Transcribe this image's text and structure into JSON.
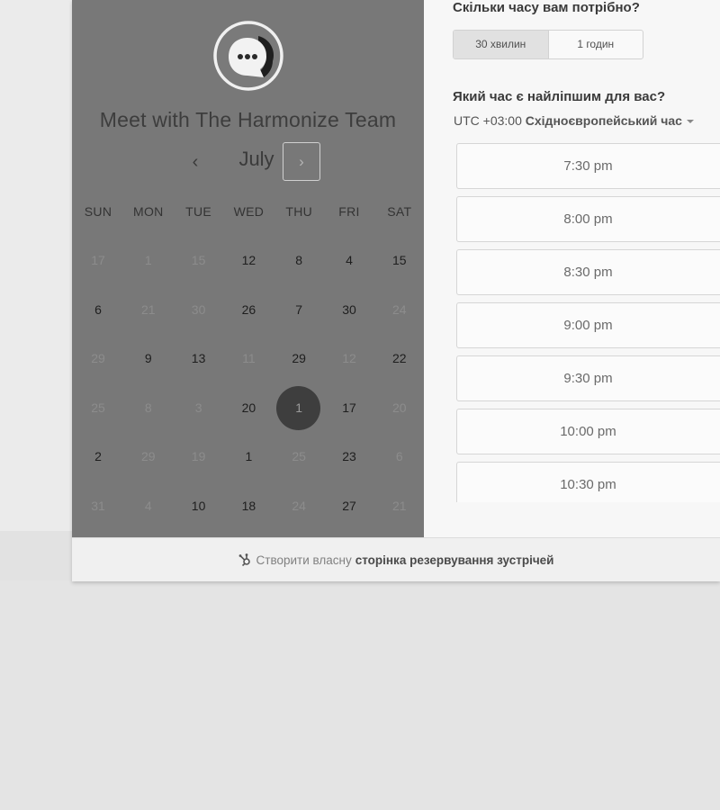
{
  "organizer": {
    "title": "Meet with The Harmonize Team",
    "logo_icon": "chat-bubble-dots-icon"
  },
  "calendar": {
    "month": "July",
    "prev_label": "‹",
    "next_label": "›",
    "weekdays": [
      "SUN",
      "MON",
      "TUE",
      "WED",
      "THU",
      "FRI",
      "SAT"
    ],
    "weeks": [
      [
        {
          "d": "17",
          "s": "inactive"
        },
        {
          "d": "1",
          "s": "inactive"
        },
        {
          "d": "15",
          "s": "inactive"
        },
        {
          "d": "12",
          "s": "active"
        },
        {
          "d": "8",
          "s": "active"
        },
        {
          "d": "4",
          "s": "active"
        },
        {
          "d": "15",
          "s": "active"
        }
      ],
      [
        {
          "d": "6",
          "s": "active"
        },
        {
          "d": "21",
          "s": "inactive"
        },
        {
          "d": "30",
          "s": "inactive"
        },
        {
          "d": "26",
          "s": "active"
        },
        {
          "d": "7",
          "s": "active"
        },
        {
          "d": "30",
          "s": "active"
        },
        {
          "d": "24",
          "s": "inactive"
        }
      ],
      [
        {
          "d": "29",
          "s": "inactive"
        },
        {
          "d": "9",
          "s": "active"
        },
        {
          "d": "13",
          "s": "active"
        },
        {
          "d": "11",
          "s": "inactive"
        },
        {
          "d": "29",
          "s": "active"
        },
        {
          "d": "12",
          "s": "inactive"
        },
        {
          "d": "22",
          "s": "active"
        }
      ],
      [
        {
          "d": "25",
          "s": "inactive"
        },
        {
          "d": "8",
          "s": "inactive"
        },
        {
          "d": "3",
          "s": "inactive"
        },
        {
          "d": "20",
          "s": "active"
        },
        {
          "d": "1",
          "s": "selected"
        },
        {
          "d": "17",
          "s": "active"
        },
        {
          "d": "20",
          "s": "inactive"
        }
      ],
      [
        {
          "d": "2",
          "s": "active"
        },
        {
          "d": "29",
          "s": "inactive"
        },
        {
          "d": "19",
          "s": "inactive"
        },
        {
          "d": "1",
          "s": "active"
        },
        {
          "d": "25",
          "s": "inactive"
        },
        {
          "d": "23",
          "s": "active"
        },
        {
          "d": "6",
          "s": "inactive"
        }
      ],
      [
        {
          "d": "31",
          "s": "inactive"
        },
        {
          "d": "4",
          "s": "inactive"
        },
        {
          "d": "10",
          "s": "active"
        },
        {
          "d": "18",
          "s": "active"
        },
        {
          "d": "24",
          "s": "inactive"
        },
        {
          "d": "27",
          "s": "active"
        },
        {
          "d": "21",
          "s": "inactive"
        }
      ]
    ]
  },
  "duration": {
    "question": "Скільки часу вам потрібно?",
    "options": [
      "30 хвилин",
      "1 годин"
    ],
    "selected_index": 0
  },
  "timeslots": {
    "question": "Який час є найліпшим для вас?",
    "timezone_offset": "UTC +03:00",
    "timezone_name": "Східноєвропейський час",
    "slots": [
      "7:30 pm",
      "8:00 pm",
      "8:30 pm",
      "9:00 pm",
      "9:30 pm",
      "10:00 pm",
      "10:30 pm"
    ]
  },
  "footer": {
    "prefix": "Створити власну",
    "bold": "сторінка резервування зустрічей",
    "icon": "hubspot-sprocket-icon"
  }
}
